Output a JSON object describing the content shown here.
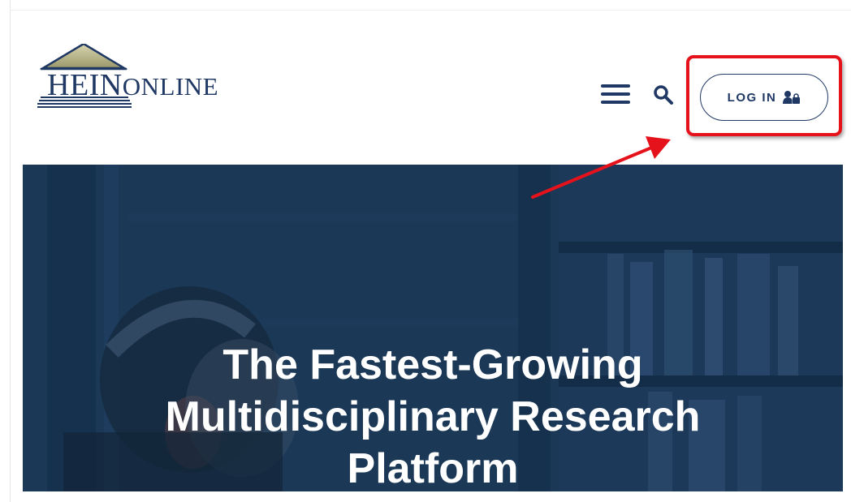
{
  "header": {
    "logo": {
      "text_first": "HEIN",
      "text_second": "ONLINE"
    },
    "menu_icon": "hamburger-menu-icon",
    "search_icon": "magnifier-search-icon",
    "login": {
      "label": "LOG IN",
      "icon": "user-lock-icon"
    }
  },
  "annotation": {
    "highlight_color": "#e5121b"
  },
  "hero": {
    "title_lines": [
      "The Fastest-Growing",
      "Multidisciplinary Research",
      "Platform"
    ]
  },
  "colors": {
    "brand_navy": "#1f3864",
    "hero_overlay": "#1b3857",
    "annotation_red": "#e5121b"
  }
}
